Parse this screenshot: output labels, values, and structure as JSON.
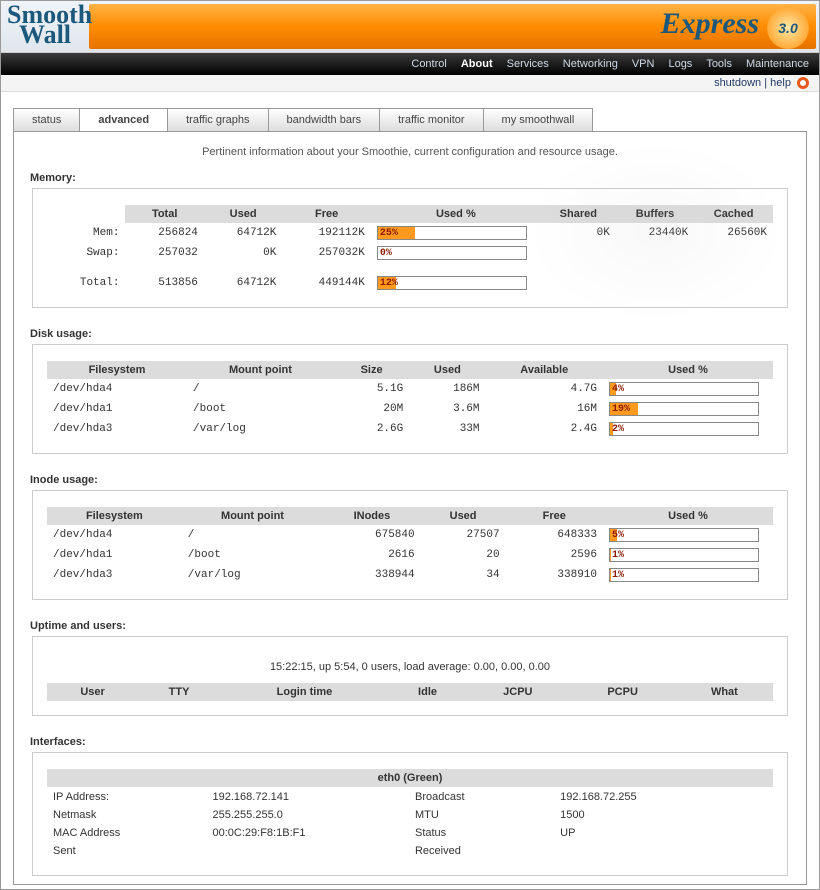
{
  "brand": {
    "name": "SmoothWall",
    "product": "Express",
    "version": "3.0"
  },
  "nav": {
    "items": [
      "Control",
      "About",
      "Services",
      "Networking",
      "VPN",
      "Logs",
      "Tools",
      "Maintenance"
    ],
    "active": "About"
  },
  "subbar": {
    "shutdown": "shutdown",
    "sep": " | ",
    "help": "help"
  },
  "tabs": {
    "items": [
      "status",
      "advanced",
      "traffic graphs",
      "bandwidth bars",
      "traffic monitor",
      "my smoothwall"
    ],
    "active": "advanced"
  },
  "intro": "Pertinent information about your Smoothie, current configuration and resource usage.",
  "memory": {
    "title": "Memory:",
    "headers": [
      "Total",
      "Used",
      "Free",
      "Used %",
      "Shared",
      "Buffers",
      "Cached"
    ],
    "rows": [
      {
        "label": "Mem:",
        "total": "256824",
        "used": "64712K",
        "free": "192112K",
        "pct": 25,
        "shared": "0K",
        "buffers": "23440K",
        "cached": "26560K"
      },
      {
        "label": "Swap:",
        "total": "257032",
        "used": "0K",
        "free": "257032K",
        "pct": 0,
        "shared": "",
        "buffers": "",
        "cached": ""
      }
    ],
    "totals": {
      "label": "Total:",
      "total": "513856",
      "used": "64712K",
      "free": "449144K",
      "pct": 12
    }
  },
  "disk": {
    "title": "Disk usage:",
    "headers": [
      "Filesystem",
      "Mount point",
      "Size",
      "Used",
      "Available",
      "Used %"
    ],
    "rows": [
      {
        "fs": "/dev/hda4",
        "mp": "/",
        "size": "5.1G",
        "used": "186M",
        "avail": "4.7G",
        "pct": 4
      },
      {
        "fs": "/dev/hda1",
        "mp": "/boot",
        "size": "20M",
        "used": "3.6M",
        "avail": "16M",
        "pct": 19
      },
      {
        "fs": "/dev/hda3",
        "mp": "/var/log",
        "size": "2.6G",
        "used": "33M",
        "avail": "2.4G",
        "pct": 2
      }
    ]
  },
  "inode": {
    "title": "Inode usage:",
    "headers": [
      "Filesystem",
      "Mount point",
      "INodes",
      "Used",
      "Free",
      "Used %"
    ],
    "rows": [
      {
        "fs": "/dev/hda4",
        "mp": "/",
        "inodes": "675840",
        "used": "27507",
        "free": "648333",
        "pct": 5
      },
      {
        "fs": "/dev/hda1",
        "mp": "/boot",
        "inodes": "2616",
        "used": "20",
        "free": "2596",
        "pct": 1
      },
      {
        "fs": "/dev/hda3",
        "mp": "/var/log",
        "inodes": "338944",
        "used": "34",
        "free": "338910",
        "pct": 1
      }
    ]
  },
  "uptime": {
    "title": "Uptime and users:",
    "line": "15:22:15, up 5:54, 0 users, load average: 0.00, 0.00, 0.00",
    "headers": [
      "User",
      "TTY",
      "Login time",
      "Idle",
      "JCPU",
      "PCPU",
      "What"
    ]
  },
  "interfaces": {
    "title": "Interfaces:",
    "iface": {
      "name": "eth0 (Green)",
      "rows": [
        {
          "k": "IP Address:",
          "v": "192.168.72.141",
          "k2": "Broadcast",
          "v2": "192.168.72.255"
        },
        {
          "k": "Netmask",
          "v": "255.255.255.0",
          "k2": "MTU",
          "v2": "1500"
        },
        {
          "k": "MAC Address",
          "v": "00:0C:29:F8:1B:F1",
          "k2": "Status",
          "v2": "UP"
        },
        {
          "k": "Sent",
          "v": "",
          "k2": "Received",
          "v2": ""
        }
      ]
    }
  }
}
